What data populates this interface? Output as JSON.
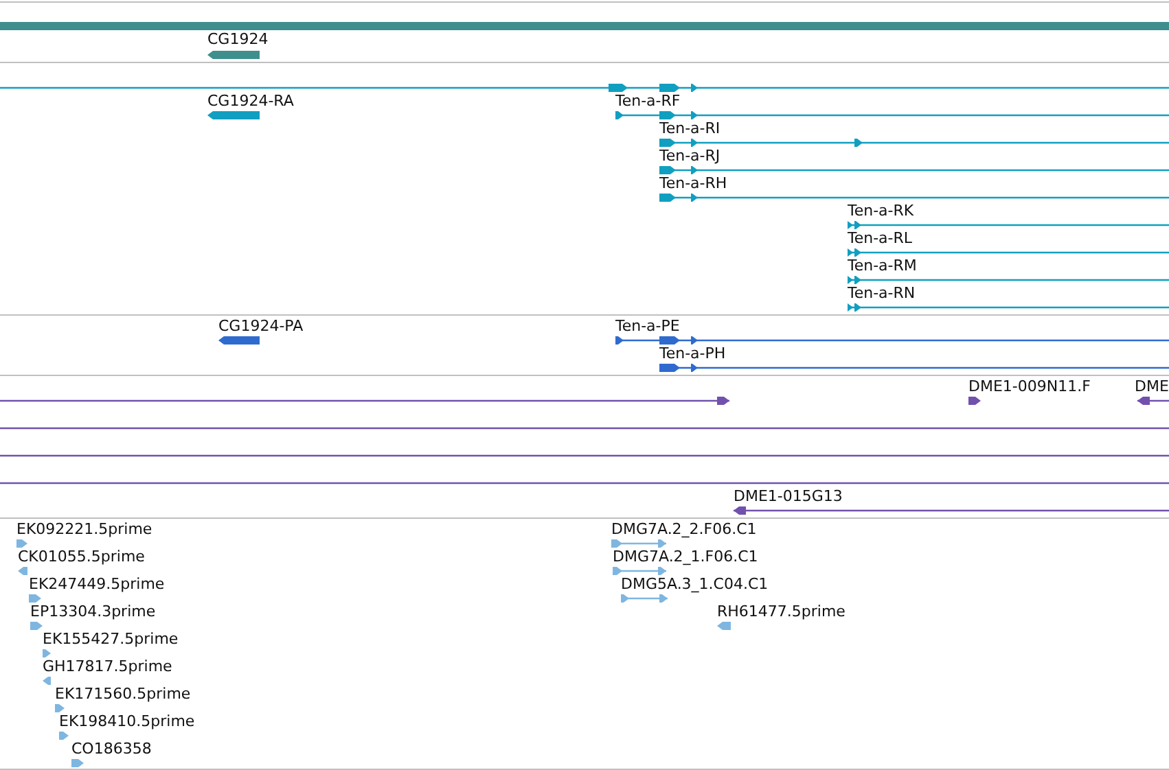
{
  "tracks": [
    {
      "color": "#3f8f8f",
      "features": [
        {
          "label": "CG1924",
          "kind": "reverse"
        }
      ]
    },
    {
      "color": "#119fc1",
      "features": [
        {
          "label": "CG1924-RA",
          "kind": "reverse"
        },
        {
          "label": "Ten-a-RF",
          "kind": "forward"
        },
        {
          "label": "Ten-a-RI",
          "kind": "forward"
        },
        {
          "label": "Ten-a-RJ",
          "kind": "forward"
        },
        {
          "label": "Ten-a-RH",
          "kind": "forward"
        },
        {
          "label": "Ten-a-RK",
          "kind": "forward"
        },
        {
          "label": "Ten-a-RL",
          "kind": "forward"
        },
        {
          "label": "Ten-a-RM",
          "kind": "forward"
        },
        {
          "label": "Ten-a-RN",
          "kind": "forward"
        }
      ]
    },
    {
      "color": "#2f6bcf",
      "features": [
        {
          "label": "CG1924-PA",
          "kind": "reverse"
        },
        {
          "label": "Ten-a-PE",
          "kind": "forward"
        },
        {
          "label": "Ten-a-PH",
          "kind": "forward"
        }
      ]
    },
    {
      "color": "#7151ad",
      "features": [
        {
          "label": "DME1-009N11.F",
          "kind": "forward"
        },
        {
          "label": "DME",
          "kind": "reverse"
        },
        {
          "label": "DME1-015G13",
          "kind": "reverse"
        }
      ]
    },
    {
      "color": "#7fb6e0",
      "features": [
        {
          "label": "EK092221.5prime",
          "kind": "forward"
        },
        {
          "label": "CK01055.5prime",
          "kind": "reverse"
        },
        {
          "label": "EK247449.5prime",
          "kind": "forward"
        },
        {
          "label": "EP13304.3prime",
          "kind": "forward"
        },
        {
          "label": "EK155427.5prime",
          "kind": "forward"
        },
        {
          "label": "GH17817.5prime",
          "kind": "reverse"
        },
        {
          "label": "EK171560.5prime",
          "kind": "forward"
        },
        {
          "label": "EK198410.5prime",
          "kind": "forward"
        },
        {
          "label": "CO186358",
          "kind": "forward"
        },
        {
          "label": "DMG7A.2_2.F06.C1",
          "kind": "forward"
        },
        {
          "label": "DMG7A.2_1.F06.C1",
          "kind": "forward"
        },
        {
          "label": "DMG5A.3_1.C04.C1",
          "kind": "forward"
        },
        {
          "label": "RH61477.5prime",
          "kind": "reverse"
        }
      ]
    }
  ]
}
